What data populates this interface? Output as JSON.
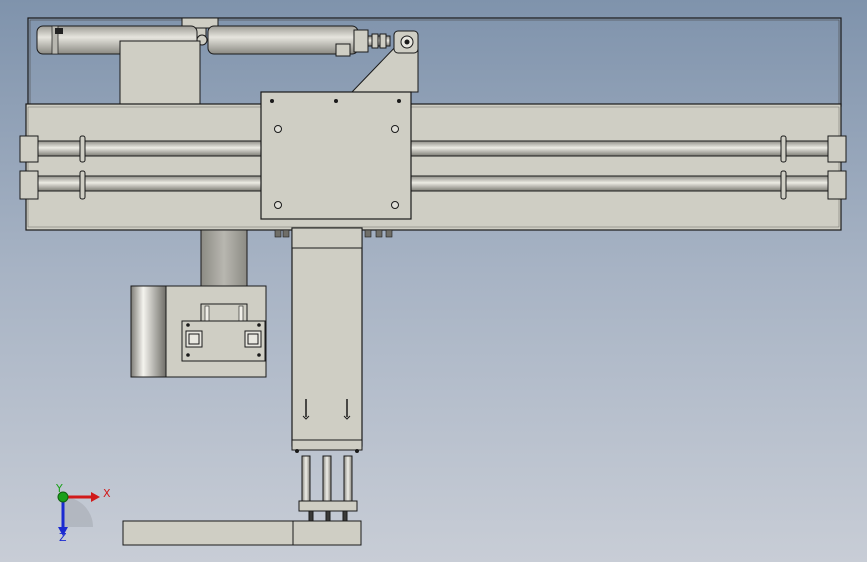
{
  "view": {
    "type": "cad-orthographic-front-view",
    "background_top": "#7f93ac",
    "background_bottom": "#c8cdd6",
    "part_fill": "#cfcec4",
    "edge_color": "#1a1a1a"
  },
  "triad": {
    "x_label": "X",
    "y_label": "Y",
    "z_label": "Z",
    "x_color": "#d11a1a",
    "y_color": "#1aa01a",
    "z_color": "#1a2ad1"
  }
}
